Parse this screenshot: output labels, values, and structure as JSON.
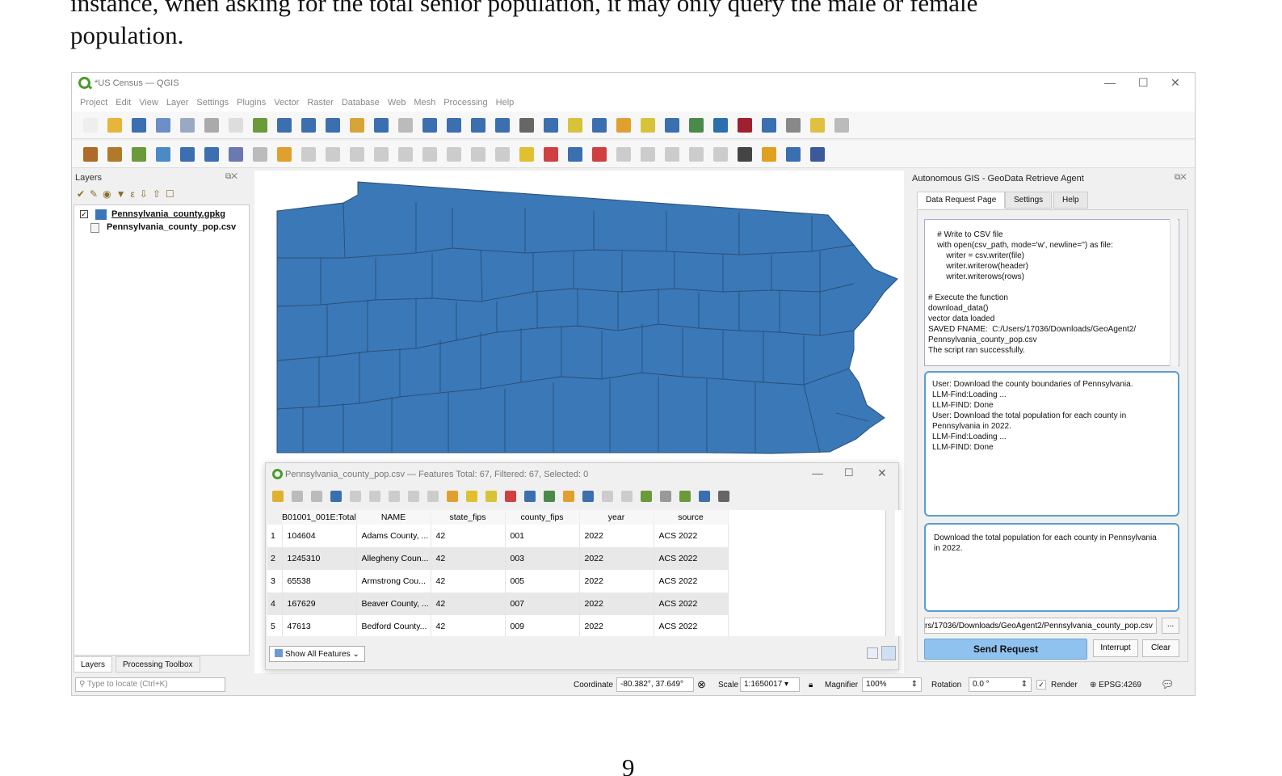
{
  "document": {
    "line1": "instance, when asking for the total senior population, it may only query the male or female",
    "line2": "population.",
    "page_number": "9"
  },
  "window": {
    "title": "*US Census — QGIS",
    "menus": [
      "Project",
      "Edit",
      "View",
      "Layer",
      "Settings",
      "Plugins",
      "Vector",
      "Raster",
      "Database",
      "Web",
      "Mesh",
      "Processing",
      "Help"
    ]
  },
  "layers_panel": {
    "title": "Layers",
    "items": [
      {
        "name": "Pennsylvania_county.gpkg",
        "checked": true,
        "color": "#3a78b8"
      },
      {
        "name": "Pennsylvania_county_pop.csv"
      }
    ],
    "tabs": [
      "Layers",
      "Processing Toolbox"
    ],
    "locate_placeholder": "Type to locate (Ctrl+K)"
  },
  "attribute_table": {
    "title": "Pennsylvania_county_pop.csv — Features Total: 67, Filtered: 67, Selected: 0",
    "columns": [
      "B01001_001E:Total",
      "NAME",
      "state_fips",
      "county_fips",
      "year",
      "source"
    ],
    "rows": [
      [
        "1",
        "104604",
        "Adams County, ...",
        "42",
        "001",
        "2022",
        "ACS 2022"
      ],
      [
        "2",
        "1245310",
        "Allegheny Coun...",
        "42",
        "003",
        "2022",
        "ACS 2022"
      ],
      [
        "3",
        "65538",
        "Armstrong Cou...",
        "42",
        "005",
        "2022",
        "ACS 2022"
      ],
      [
        "4",
        "167629",
        "Beaver County, ...",
        "42",
        "007",
        "2022",
        "ACS 2022"
      ],
      [
        "5",
        "47613",
        "Bedford County...",
        "42",
        "009",
        "2022",
        "ACS 2022"
      ]
    ],
    "show_all": "Show All Features"
  },
  "agent_panel": {
    "title": "Autonomous GIS - GeoData Retrieve Agent",
    "tabs": [
      "Data Request Page",
      "Settings",
      "Help"
    ],
    "code_output": "    # Write to CSV file\n    with open(csv_path, mode='w', newline='') as file:\n        writer = csv.writer(file)\n        writer.writerow(header)\n        writer.writerows(rows)\n\n# Execute the function\ndownload_data()\nvector data loaded\nSAVED FNAME:  C:/Users/17036/Downloads/GeoAgent2/\nPennsylvania_county_pop.csv\nThe script ran successfully.",
    "log": "User: Download the county boundaries of Pennsylvania.\nLLM-Find:Loading ...\nLLM-FIND: Done\nUser: Download the total population for each county in\nPennsylvania in 2022.\nLLM-Find:Loading ...\nLLM-FIND: Done",
    "request_text": "Download the total population for each county in Pennsylvania\nin 2022.",
    "path": "rs/17036/Downloads/GeoAgent2/Pennsylvania_county_pop.csv",
    "browse": "...",
    "send": "Send Request",
    "interrupt": "Interrupt",
    "clear": "Clear"
  },
  "status_bar": {
    "coordinate_label": "Coordinate",
    "coordinate": "-80.382°, 37.649°",
    "scale_label": "Scale",
    "scale": "1:1650017",
    "magnifier_label": "Magnifier",
    "magnifier": "100%",
    "rotation_label": "Rotation",
    "rotation": "0.0 °",
    "render_label": "Render",
    "crs": "EPSG:4269"
  }
}
